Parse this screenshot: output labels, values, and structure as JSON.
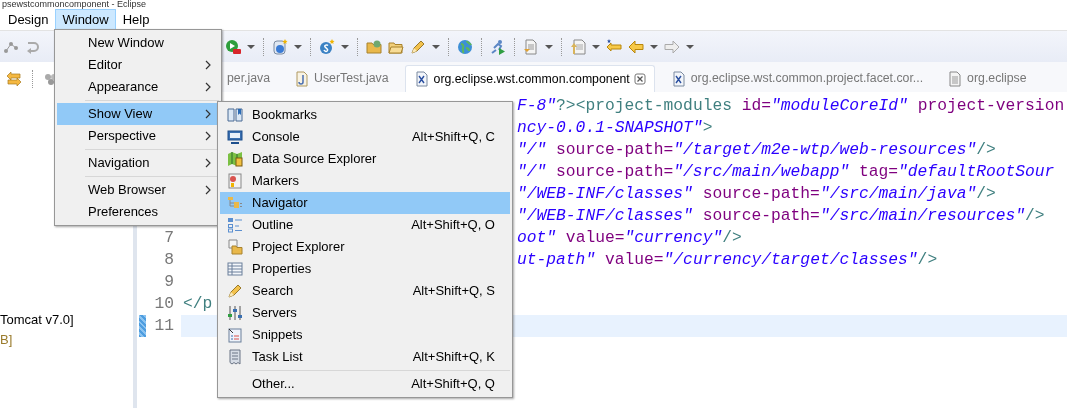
{
  "window": {
    "title": "psewstcommoncomponent - Eclipse"
  },
  "menubar": [
    {
      "label": "Design",
      "selected": false
    },
    {
      "label": "Window",
      "selected": true
    },
    {
      "label": "Help",
      "selected": false
    }
  ],
  "window_menu": [
    {
      "kind": "item",
      "label": "New Window",
      "selected": false
    },
    {
      "kind": "submenu",
      "label": "Editor",
      "selected": false
    },
    {
      "kind": "submenu",
      "label": "Appearance",
      "selected": false
    },
    {
      "kind": "separator"
    },
    {
      "kind": "submenu",
      "label": "Show View",
      "selected": true
    },
    {
      "kind": "submenu",
      "label": "Perspective",
      "selected": false
    },
    {
      "kind": "separator"
    },
    {
      "kind": "submenu",
      "label": "Navigation",
      "selected": false
    },
    {
      "kind": "separator"
    },
    {
      "kind": "submenu",
      "label": "Web Browser",
      "selected": false
    },
    {
      "kind": "item",
      "label": "Preferences",
      "selected": false
    }
  ],
  "show_view_menu": [
    {
      "kind": "item",
      "label": "Bookmarks",
      "selected": false
    },
    {
      "kind": "item",
      "label": "Console",
      "shortcut": "Alt+Shift+Q, C",
      "selected": false
    },
    {
      "kind": "item",
      "label": "Data Source Explorer",
      "selected": false
    },
    {
      "kind": "item",
      "label": "Markers",
      "selected": false
    },
    {
      "kind": "item",
      "label": "Navigator",
      "selected": true
    },
    {
      "kind": "item",
      "label": "Outline",
      "shortcut": "Alt+Shift+Q, O",
      "selected": false
    },
    {
      "kind": "item",
      "label": "Project Explorer",
      "selected": false
    },
    {
      "kind": "item",
      "label": "Properties",
      "selected": false
    },
    {
      "kind": "item",
      "label": "Search",
      "shortcut": "Alt+Shift+Q, S",
      "selected": false
    },
    {
      "kind": "item",
      "label": "Servers",
      "selected": false
    },
    {
      "kind": "item",
      "label": "Snippets",
      "selected": false
    },
    {
      "kind": "item",
      "label": "Task List",
      "shortcut": "Alt+Shift+Q, K",
      "selected": false
    },
    {
      "kind": "separator"
    },
    {
      "kind": "other",
      "label": "Other...",
      "shortcut": "Alt+Shift+Q, Q",
      "selected": false
    }
  ],
  "left_panel": {
    "lines": [
      {
        "kind": "label",
        "text": "Tomcat v7.0]"
      },
      {
        "kind": "detail",
        "text": "B]"
      }
    ]
  },
  "editor_tabs": [
    {
      "label": "per.java",
      "selected": false,
      "closable": false
    },
    {
      "kind": "java",
      "label": "UserTest.java",
      "selected": false,
      "closable": false
    },
    {
      "kind": "xml",
      "label": "org.eclipse.wst.common.component",
      "selected": true,
      "closable": true
    },
    {
      "kind": "xml",
      "label": "org.eclipse.wst.common.project.facet.cor...",
      "selected": false,
      "closable": false
    },
    {
      "kind": "file",
      "label": "org.eclipse",
      "selected": false,
      "closable": false
    }
  ],
  "editor": {
    "lines": [
      {
        "kind": "after_menu",
        "current": false,
        "changed": false,
        "segments": [
          {
            "kind": "value",
            "text": "F-8\""
          },
          {
            "kind": "tag",
            "text": "?><project-modules"
          },
          {
            "kind": "attr",
            "text": " id="
          },
          {
            "kind": "value",
            "text": "\"moduleCoreId\""
          },
          {
            "kind": "attr",
            "text": " project-version"
          }
        ]
      },
      {
        "kind": "after_menu",
        "current": false,
        "changed": false,
        "segments": [
          {
            "kind": "value",
            "text": "ncy-0.0.1-SNAPSHOT\""
          },
          {
            "kind": "tag",
            "text": ">"
          }
        ]
      },
      {
        "kind": "after_menu",
        "current": false,
        "changed": false,
        "segments": [
          {
            "kind": "value",
            "text": "\"/\""
          },
          {
            "kind": "attr",
            "text": " source-path="
          },
          {
            "kind": "value",
            "text": "\"/target/m2e-wtp/web-resources\""
          },
          {
            "kind": "tag",
            "text": "/>"
          }
        ]
      },
      {
        "kind": "after_menu",
        "current": false,
        "changed": false,
        "segments": [
          {
            "kind": "value",
            "text": "\"/\""
          },
          {
            "kind": "attr",
            "text": " source-path="
          },
          {
            "kind": "value",
            "text": "\"/src/main/webapp\""
          },
          {
            "kind": "attr",
            "text": " tag="
          },
          {
            "kind": "value",
            "text": "\"defaultRootSour"
          }
        ]
      },
      {
        "kind": "after_menu",
        "current": false,
        "changed": false,
        "segments": [
          {
            "kind": "value",
            "text": "\"/WEB-INF/classes\""
          },
          {
            "kind": "attr",
            "text": " source-path="
          },
          {
            "kind": "value",
            "text": "\"/src/main/java\""
          },
          {
            "kind": "tag",
            "text": "/>"
          }
        ]
      },
      {
        "kind": "after_menu",
        "current": false,
        "changed": false,
        "segments": [
          {
            "kind": "value",
            "text": "\"/WEB-INF/classes\""
          },
          {
            "kind": "attr",
            "text": " source-path="
          },
          {
            "kind": "value",
            "text": "\"/src/main/resources\""
          },
          {
            "kind": "tag",
            "text": "/>"
          }
        ]
      },
      {
        "number": "7",
        "kind": "after_menu",
        "current": false,
        "changed": false,
        "segments": [
          {
            "kind": "value",
            "text": "oot\""
          },
          {
            "kind": "attr",
            "text": " value="
          },
          {
            "kind": "value",
            "text": "\"currency\""
          },
          {
            "kind": "tag",
            "text": "/>"
          }
        ]
      },
      {
        "number": "8",
        "kind": "after_menu",
        "current": false,
        "changed": false,
        "segments": [
          {
            "kind": "value",
            "text": "ut-path\""
          },
          {
            "kind": "attr",
            "text": " value="
          },
          {
            "kind": "value",
            "text": "\"/currency/target/classes\""
          },
          {
            "kind": "tag",
            "text": "/>"
          }
        ]
      },
      {
        "number": "9",
        "kind": "full",
        "current": false,
        "changed": false
      },
      {
        "number": "10",
        "kind": "full",
        "current": false,
        "changed": false,
        "segments": [
          {
            "kind": "tag",
            "text": "</p"
          }
        ]
      },
      {
        "number": "11",
        "kind": "full",
        "current": true,
        "changed": true
      }
    ]
  }
}
